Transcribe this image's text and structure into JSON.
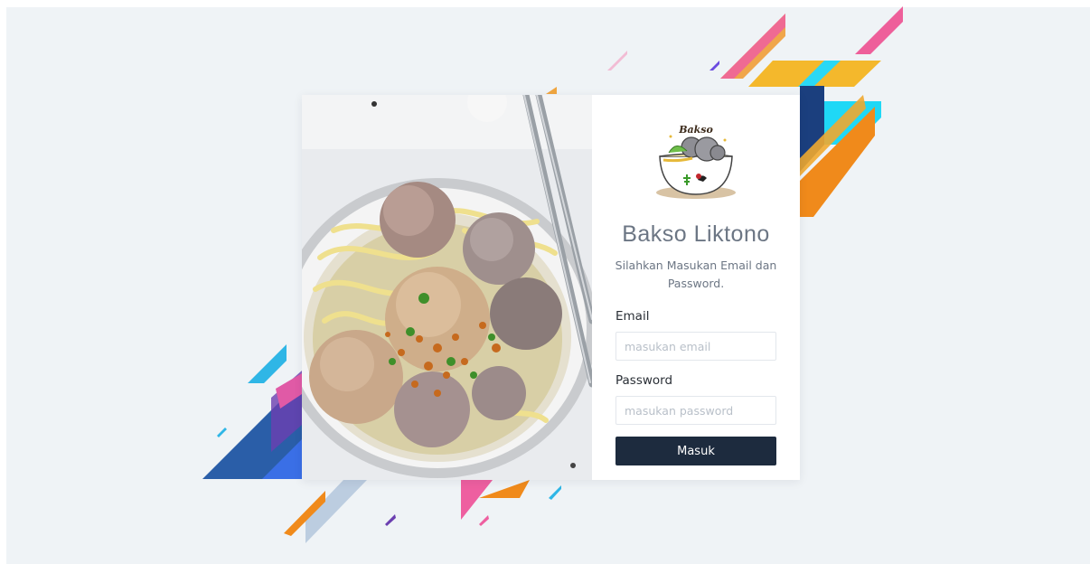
{
  "brand": {
    "logo_text": "Bakso",
    "title": "Bakso Liktono",
    "subtitle": "Silahkan Masukan Email dan Password."
  },
  "form": {
    "email": {
      "label": "Email",
      "placeholder": "masukan email",
      "value": ""
    },
    "password": {
      "label": "Password",
      "placeholder": "masukan password",
      "value": ""
    },
    "submit_label": "Masuk"
  },
  "colors": {
    "page_background": "#eff3f6",
    "primary_button": "#1d2b3e",
    "title_text": "#6c7684"
  },
  "icons": {
    "logo": "bakso-bowl-logo"
  },
  "images": {
    "hero": "bakso-meatball-noodle-soup-photo"
  }
}
